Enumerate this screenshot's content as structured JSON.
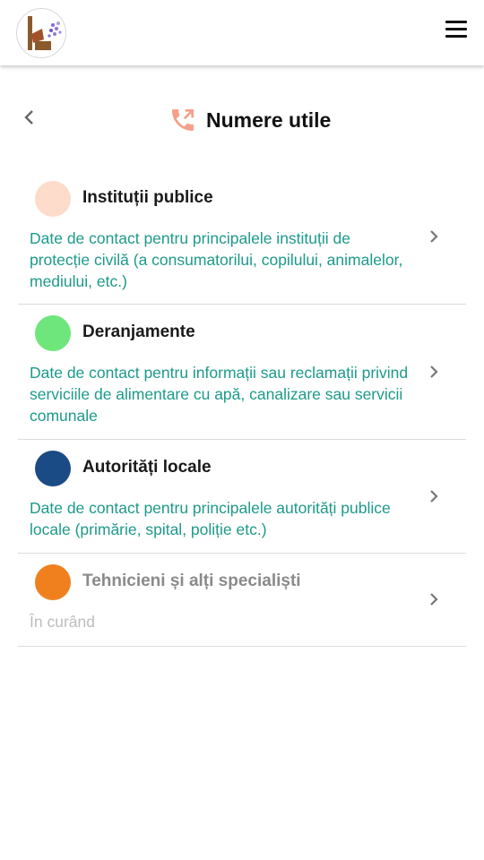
{
  "header": {
    "logo_icon": "app-logo-icon",
    "menu_icon": "hamburger-menu-icon"
  },
  "page": {
    "title": "Numere utile",
    "title_icon": "phone-call-icon",
    "back_icon": "chevron-left-icon"
  },
  "categories": [
    {
      "title": "Instituții publice",
      "description": "Date de contact pentru principalele instituții de protecție civilă (a consumatorilui, copilului, animalelor, mediului, etc.)",
      "color": "#fddccb"
    },
    {
      "title": "Deranjamente",
      "description": "Date de contact pentru informații sau reclamații privind serviciile de alimentare cu apă, canalizare sau servicii comunale",
      "color": "#6ee67b"
    },
    {
      "title": "Autorități locale",
      "description": "Date de contact pentru principalele autorități publice locale (primărie, spital, poliție etc.)",
      "color": "#1b4b84"
    },
    {
      "title": "Tehnicieni și alți specialiști",
      "description": "În curând",
      "color": "#f0801e"
    }
  ],
  "colors": {
    "accent_teal": "#1d9a8a",
    "phone_icon": "#f5a08a",
    "disabled_text": "#bdbdbd"
  }
}
